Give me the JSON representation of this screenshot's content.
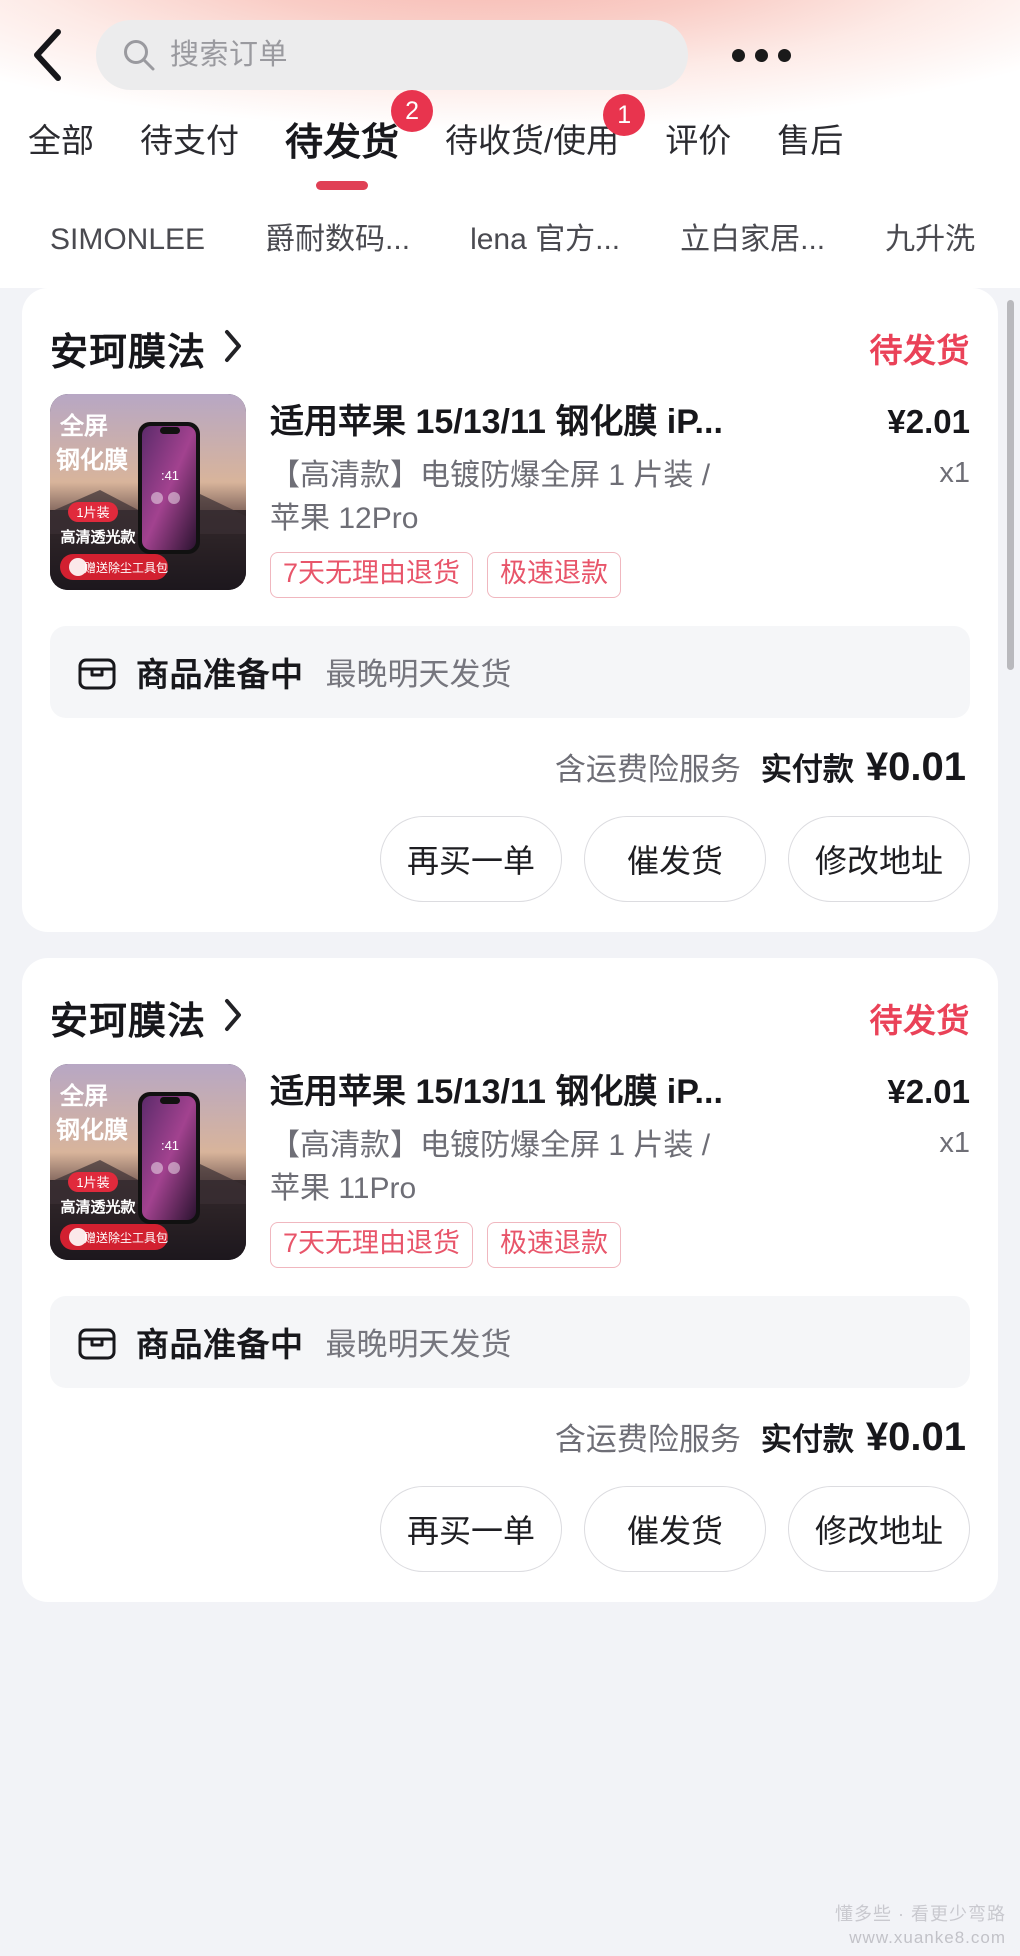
{
  "header": {
    "back_icon": "chevron-left-icon",
    "search_icon": "search-icon",
    "search_placeholder": "搜索订单",
    "more_icon": "more-horizontal-icon"
  },
  "tabs": [
    {
      "label": "全部",
      "badge": "",
      "active": false
    },
    {
      "label": "待支付",
      "badge": "",
      "active": false
    },
    {
      "label": "待发货",
      "badge": "2",
      "active": true
    },
    {
      "label": "待收货/使用",
      "badge": "1",
      "active": false
    },
    {
      "label": "评价",
      "badge": "",
      "active": false
    },
    {
      "label": "售后",
      "badge": "",
      "active": false
    }
  ],
  "shop_chips": [
    {
      "label": "SIMONLEE"
    },
    {
      "label": "爵耐数码..."
    },
    {
      "label": "lena 官方..."
    },
    {
      "label": "立白家居..."
    },
    {
      "label": "九升洗"
    }
  ],
  "colors": {
    "accent_red": "#e04055",
    "badge_red": "#e8344e",
    "status_red": "#ea4258",
    "tag_red": "#e8556a",
    "page_bg": "#f2f3f7"
  },
  "orders": [
    {
      "shop_name": "安珂膜法",
      "shop_arrow_icon": "chevron-right-icon",
      "status": "待发货",
      "product": {
        "thumb_labels": [
          "全屏",
          "钢化膜",
          "1片装",
          "高清透光款",
          "赠送除尘工具包"
        ],
        "title": "适用苹果 15/13/11 钢化膜 iP...",
        "price": "¥2.01",
        "spec": "【高清款】电镀防爆全屏 1 片装 / 苹果 12Pro",
        "qty": "x1",
        "tags": [
          "7天无理由退货",
          "极速退款"
        ]
      },
      "shipping": {
        "icon": "package-icon",
        "status": "商品准备中",
        "note": "最晚明天发货"
      },
      "payment": {
        "insurance": "含运费险服务",
        "label": "实付款",
        "amount": "¥0.01"
      },
      "actions": [
        "再买一单",
        "催发货",
        "修改地址"
      ]
    },
    {
      "shop_name": "安珂膜法",
      "shop_arrow_icon": "chevron-right-icon",
      "status": "待发货",
      "product": {
        "thumb_labels": [
          "全屏",
          "钢化膜",
          "1片装",
          "高清透光款",
          "赠送除尘工具包"
        ],
        "title": "适用苹果 15/13/11 钢化膜 iP...",
        "price": "¥2.01",
        "spec": "【高清款】电镀防爆全屏 1 片装 / 苹果 11Pro",
        "qty": "x1",
        "tags": [
          "7天无理由退货",
          "极速退款"
        ]
      },
      "shipping": {
        "icon": "package-icon",
        "status": "商品准备中",
        "note": "最晚明天发货"
      },
      "payment": {
        "insurance": "含运费险服务",
        "label": "实付款",
        "amount": "¥0.01"
      },
      "actions": [
        "再买一单",
        "催发货",
        "修改地址"
      ]
    }
  ],
  "watermark": {
    "line1": "懂多些 · 看更少弯路",
    "line2": "www.xuanke8.com"
  }
}
